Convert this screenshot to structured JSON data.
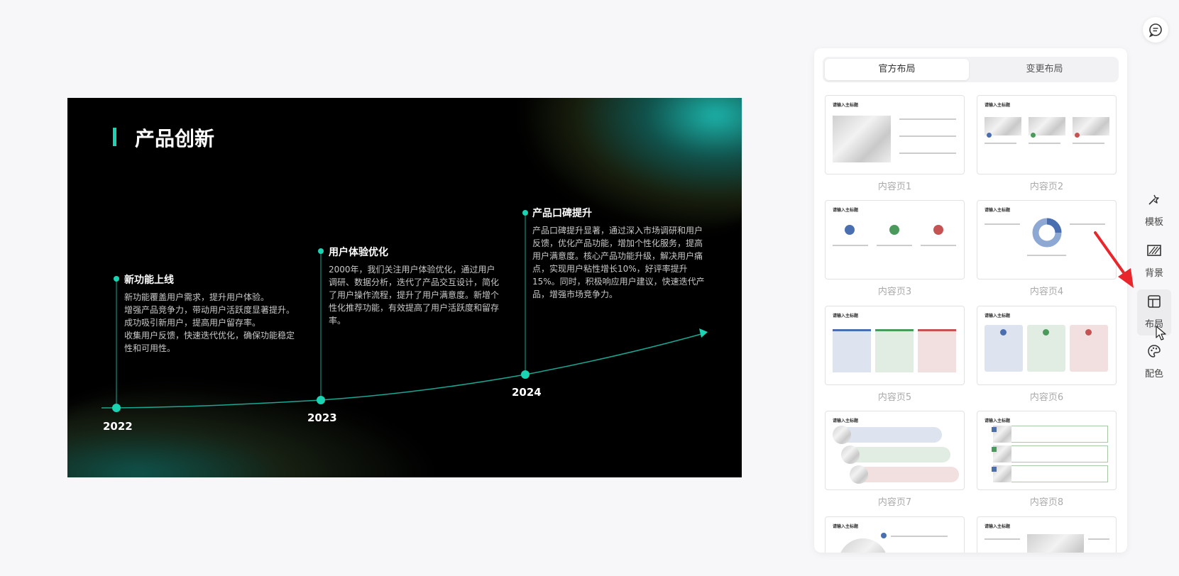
{
  "slide": {
    "title": "产品创新",
    "milestones": [
      {
        "heading": "新功能上线",
        "body": "新功能覆盖用户需求，提升用户体验。\n增强产品竞争力，带动用户活跃度显著提升。\n成功吸引新用户，提高用户留存率。\n收集用户反馈，快速迭代优化，确保功能稳定性和可用性。",
        "year": "2022"
      },
      {
        "heading": "用户体验优化",
        "body": "2000年，我们关注用户体验优化，通过用户调研、数据分析，迭代了产品交互设计，简化了用户操作流程，提升了用户满意度。新增个性化推荐功能，有效提高了用户活跃度和留存率。",
        "year": "2023"
      },
      {
        "heading": "产品口碑提升",
        "body": "产品口碑提升显著，通过深入市场调研和用户反馈，优化产品功能，增加个性化服务，提高用户满意度。核心产品功能升级，解决用户痛点，实现用户粘性增长10%，好评率提升15%。同时，积极响应用户建议，快速迭代产品，增强市场竞争力。",
        "year": "2024"
      }
    ]
  },
  "panel": {
    "tabs": [
      "官方布局",
      "变更布局"
    ],
    "thumbnails": [
      {
        "caption": "内容页1",
        "title": "请输入主标题"
      },
      {
        "caption": "内容页2",
        "title": "请输入主标题"
      },
      {
        "caption": "内容页3",
        "title": "请输入主标题"
      },
      {
        "caption": "内容页4",
        "title": "请输入主标题"
      },
      {
        "caption": "内容页5",
        "title": "请输入主标题"
      },
      {
        "caption": "内容页6",
        "title": "请输入主标题"
      },
      {
        "caption": "内容页7",
        "title": "请输入主标题"
      },
      {
        "caption": "内容页8",
        "title": "请输入主标题"
      },
      {
        "caption": "",
        "title": "请输入主标题"
      },
      {
        "caption": "",
        "title": "请输入主标题"
      }
    ]
  },
  "sidebar": {
    "items": [
      {
        "label": "模板",
        "icon": "magic-wand-icon"
      },
      {
        "label": "背景",
        "icon": "background-hatch-icon"
      },
      {
        "label": "布局",
        "icon": "layout-icon"
      },
      {
        "label": "配色",
        "icon": "palette-icon"
      }
    ]
  },
  "colors": {
    "accent": "#19d3b3",
    "arrow": "#e8262c"
  }
}
